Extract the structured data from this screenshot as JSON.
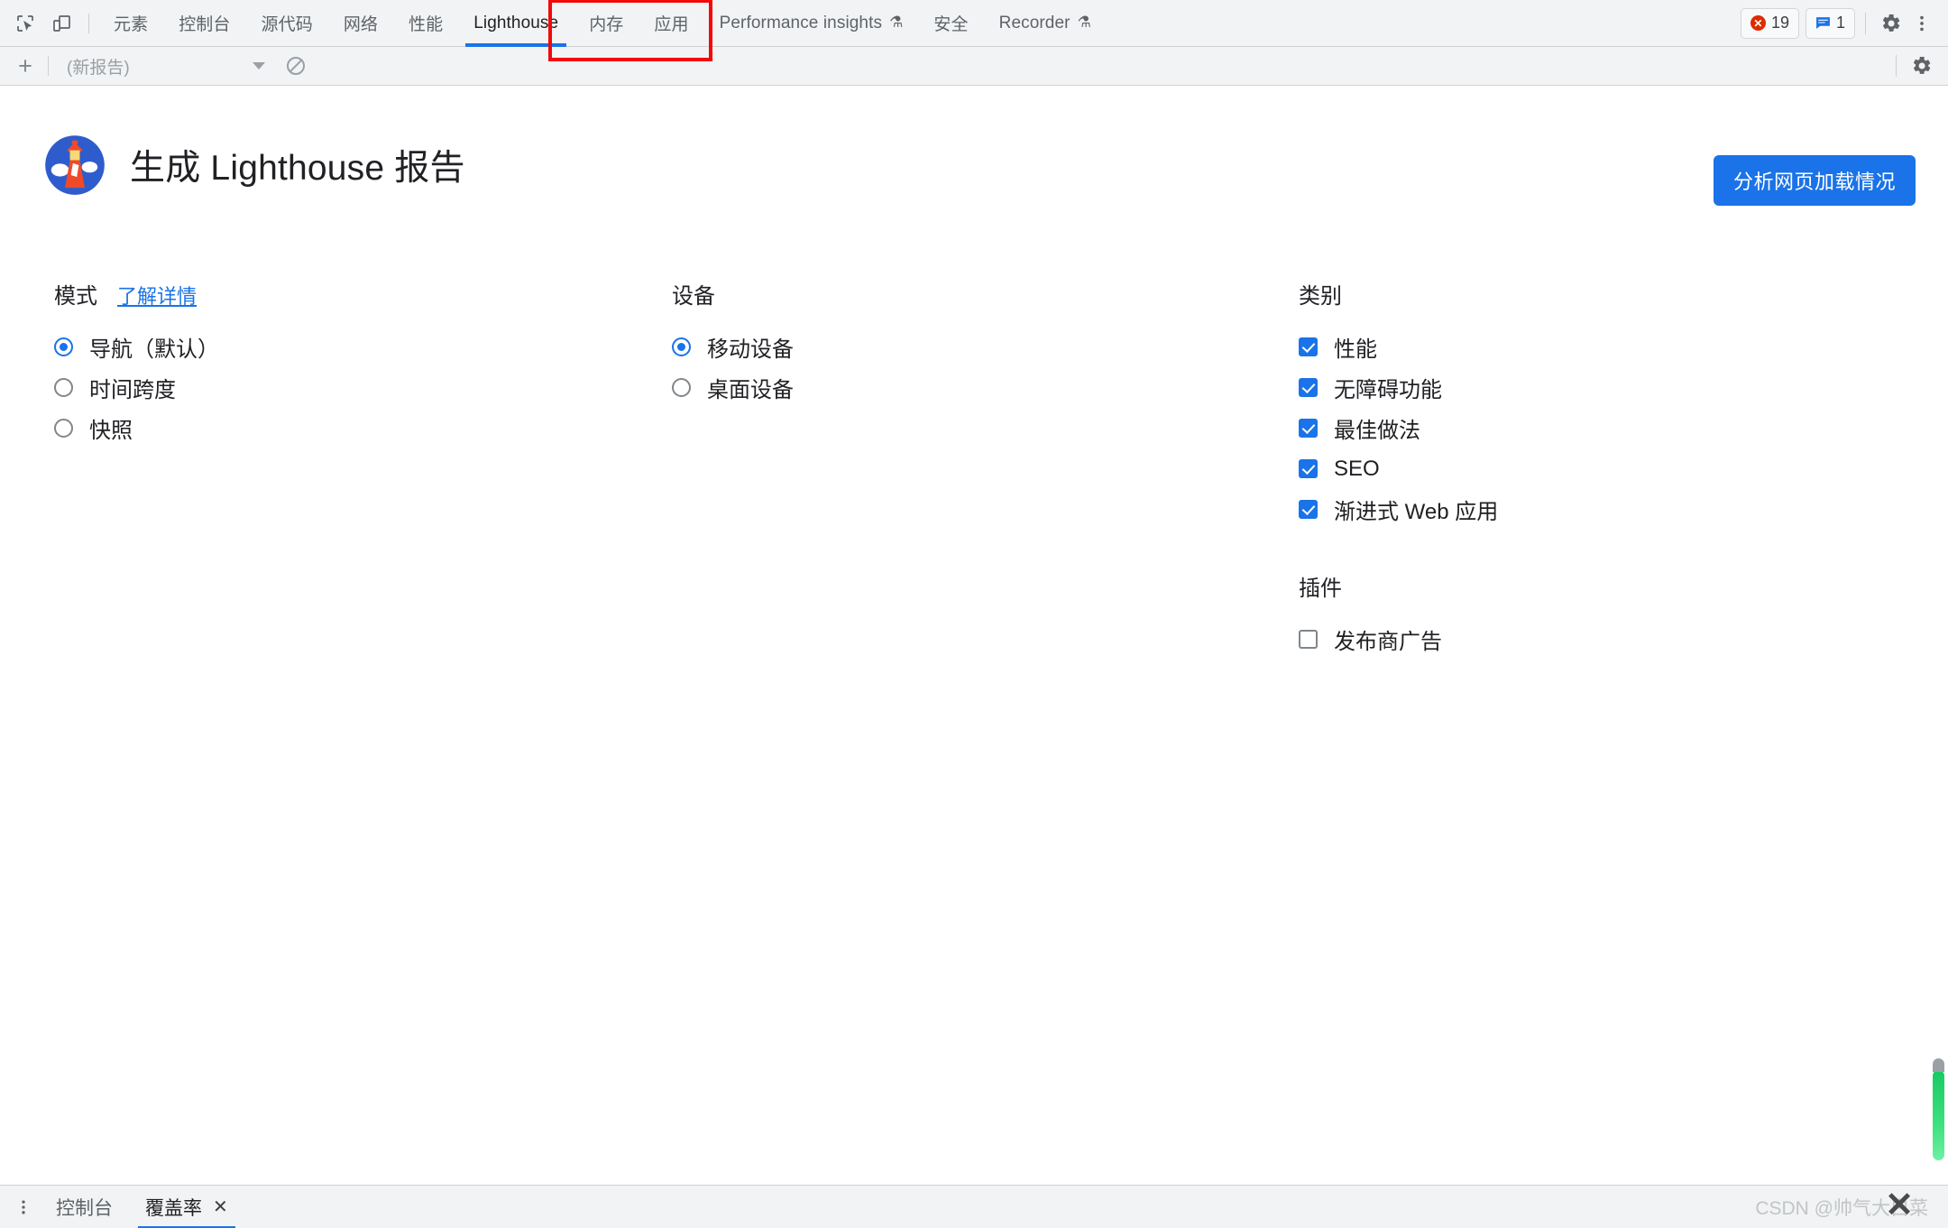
{
  "devtools": {
    "left_icons": [
      {
        "name": "inspect-element-icon"
      },
      {
        "name": "device-toolbar-icon"
      }
    ],
    "tabs": [
      {
        "label": "元素",
        "active": false,
        "experimental": false
      },
      {
        "label": "控制台",
        "active": false,
        "experimental": false
      },
      {
        "label": "源代码",
        "active": false,
        "experimental": false
      },
      {
        "label": "网络",
        "active": false,
        "experimental": false
      },
      {
        "label": "性能",
        "active": false,
        "experimental": false
      },
      {
        "label": "Lighthouse",
        "active": true,
        "experimental": false
      },
      {
        "label": "内存",
        "active": false,
        "experimental": false
      },
      {
        "label": "应用",
        "active": false,
        "experimental": false
      },
      {
        "label": "Performance insights",
        "active": false,
        "experimental": true
      },
      {
        "label": "安全",
        "active": false,
        "experimental": false
      },
      {
        "label": "Recorder",
        "active": false,
        "experimental": true
      }
    ],
    "badges": {
      "errors": "19",
      "messages": "1"
    },
    "settings_icon": "gear-icon",
    "more_icon": "kebab-menu-icon",
    "experimental_glyph": "⚗"
  },
  "toolbar": {
    "new_report_label": "+",
    "report_select_value": "(新报告)",
    "clear_icon": "no-entry-icon",
    "settings_icon": "gear-icon"
  },
  "main": {
    "logo_name": "lighthouse-logo",
    "title": "生成 Lighthouse 报告",
    "analyze_button": "分析网页加载情况",
    "mode": {
      "heading": "模式",
      "learn_more": "了解详情",
      "options": [
        {
          "label": "导航（默认）",
          "checked": true
        },
        {
          "label": "时间跨度",
          "checked": false
        },
        {
          "label": "快照",
          "checked": false
        }
      ]
    },
    "device": {
      "heading": "设备",
      "options": [
        {
          "label": "移动设备",
          "checked": true
        },
        {
          "label": "桌面设备",
          "checked": false
        }
      ]
    },
    "categories": {
      "heading": "类别",
      "options": [
        {
          "label": "性能",
          "checked": true
        },
        {
          "label": "无障碍功能",
          "checked": true
        },
        {
          "label": "最佳做法",
          "checked": true
        },
        {
          "label": "SEO",
          "checked": true
        },
        {
          "label": "渐进式 Web 应用",
          "checked": true
        }
      ]
    },
    "plugins": {
      "heading": "插件",
      "options": [
        {
          "label": "发布商广告",
          "checked": false
        }
      ]
    }
  },
  "drawer": {
    "more_icon": "kebab-menu-icon",
    "tabs": [
      {
        "label": "控制台",
        "active": false,
        "closable": false
      },
      {
        "label": "覆盖率",
        "active": true,
        "closable": true
      }
    ],
    "close_glyph": "✕",
    "watermark": "CSDN @帅气大白菜"
  },
  "colors": {
    "accent": "#1a73e8",
    "highlight_box": "#f40808",
    "toolbar_bg": "#f1f3f4",
    "error_red": "#dd2c00",
    "scrollbar_green": "#18c964"
  }
}
